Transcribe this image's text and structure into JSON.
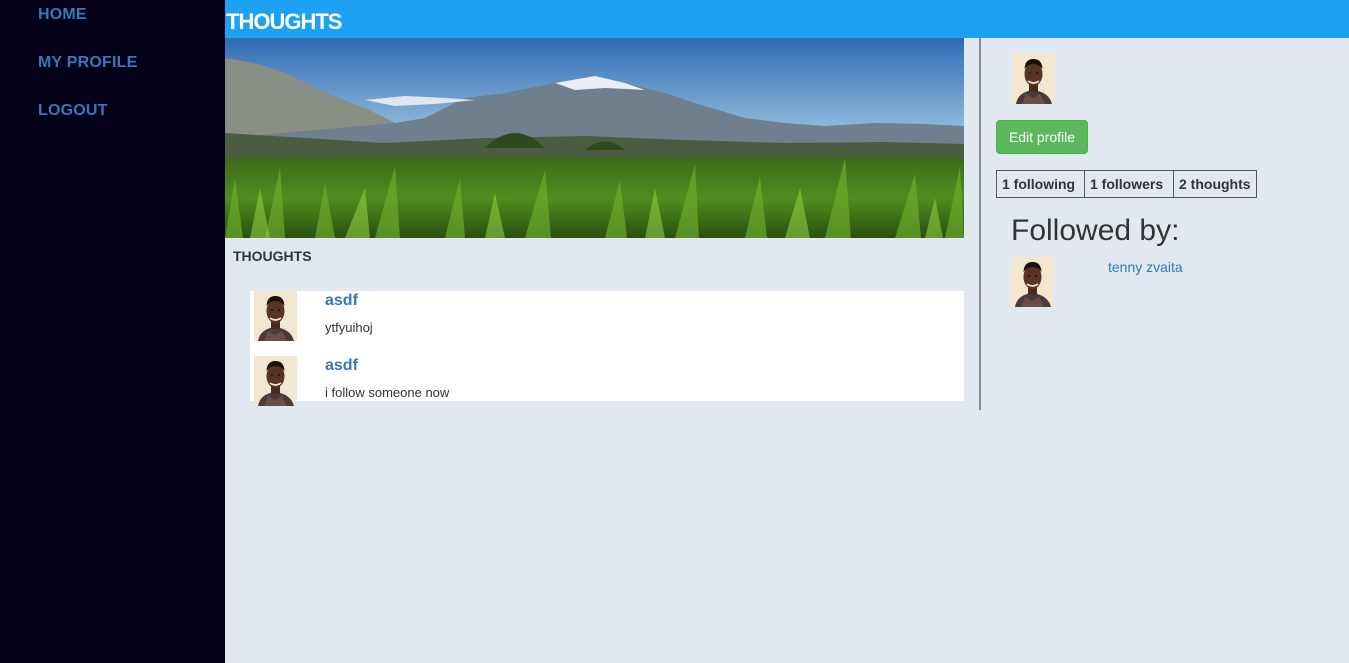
{
  "nav": {
    "home": "HOME",
    "my_profile": "MY PROFILE",
    "logout": "LOGOUT"
  },
  "header": {
    "title": "THOUGHTS"
  },
  "feed": {
    "heading": "THOUGHTS",
    "thoughts": [
      {
        "title": "asdf",
        "body": "ytfyuihoj"
      },
      {
        "title": "asdf",
        "body": "i follow someone now"
      }
    ]
  },
  "profile": {
    "edit_label": "Edit profile",
    "stats": {
      "following": "1 following",
      "followers": "1 followers",
      "thoughts": "2 thoughts"
    },
    "followed_by_heading": "Followed by:",
    "followers": [
      {
        "name": "tenny zvaita"
      }
    ]
  },
  "colors": {
    "sidebar": "#05001a",
    "topbar": "#1da1f2",
    "link": "#337ab7",
    "button": "#5cb85c",
    "background": "#e1e8ef"
  }
}
